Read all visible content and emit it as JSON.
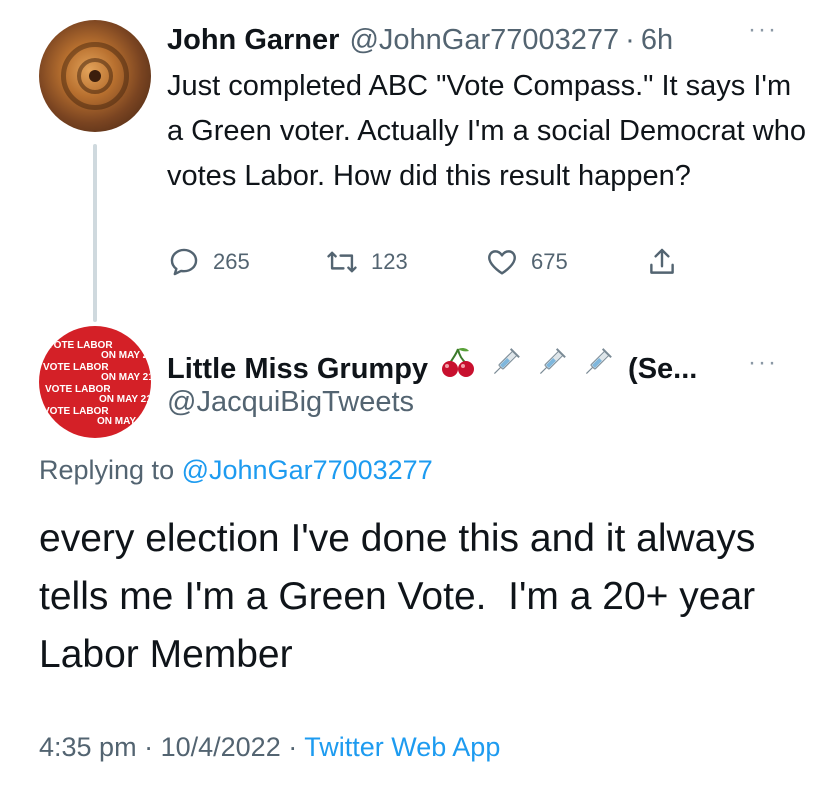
{
  "parent_tweet": {
    "author_name": "John Garner",
    "author_handle": "@JohnGar77003277",
    "separator": "·",
    "time": "6h",
    "more": "···",
    "text": "Just completed ABC \"Vote Compass.\" It says I'm a Green voter. Actually I'm a social Democrat who votes Labor. How did this result happen?",
    "replies": "265",
    "retweets": "123",
    "likes": "675"
  },
  "reply_tweet": {
    "author_name": "Little Miss Grumpy",
    "name_emoji": [
      "cherries-emoji",
      "syringe-emoji",
      "syringe-emoji",
      "syringe-emoji"
    ],
    "name_tail": "(Se...",
    "author_handle": "@JacquiBigTweets",
    "more": "···",
    "avatar_text": [
      "VOTE LABOR",
      "ON MAY 21"
    ],
    "replying_label": "Replying to",
    "replying_to": "@JohnGar77003277",
    "text": "every election I've done this and it always tells me I'm a Green Vote.  I'm a 20+ year Labor Member",
    "time": "4:35 pm",
    "date": "10/4/2022",
    "separator": "·",
    "source": "Twitter Web App"
  },
  "colors": {
    "text": "#0f1419",
    "secondary": "#536471",
    "link": "#1d9bf0",
    "thread_line": "#cfd9de",
    "avatar_red": "#d42027"
  }
}
